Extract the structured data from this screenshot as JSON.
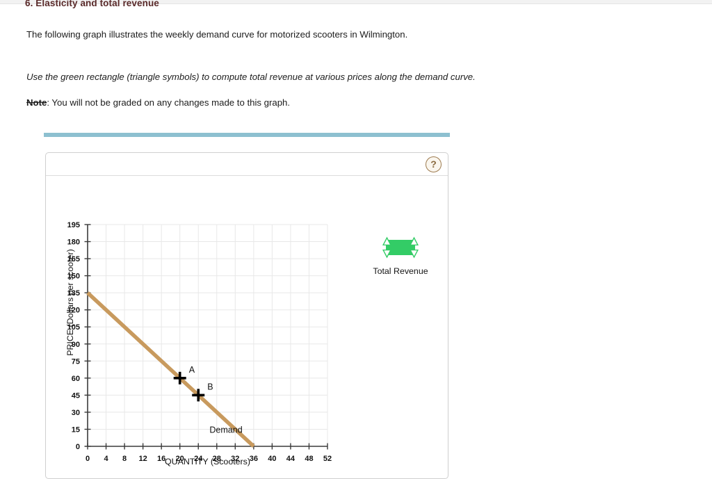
{
  "heading": "6. Elasticity and total revenue",
  "paragraphs": {
    "intro": "The following graph illustrates the weekly demand curve for motorized scooters in Wilmington.",
    "instruction": "Use the green rectangle (triangle symbols) to compute total revenue at various prices along the demand curve.",
    "note_label": "Note",
    "note_text": ": You will not be graded on any changes made to this graph."
  },
  "panel": {
    "help_icon_glyph": "?",
    "help_icon_name": "question-mark-icon"
  },
  "legend": {
    "label": "Total Revenue",
    "swatch_color": "#33cc66",
    "swatch_name": "green-rectangle-handles-icon"
  },
  "colors": {
    "teal_bar": "#8dc0d0",
    "demand_curve": "#c89a5e",
    "grid": "#e8e8e8",
    "axis": "#3a3a3a",
    "marker": "#000000",
    "heading": "#5a2a2a"
  },
  "chart_data": {
    "type": "line",
    "title": "",
    "xlabel": "QUANTITY (Scooters)",
    "ylabel": "PRICE (Dollars per scooter)",
    "xlim": [
      0,
      52
    ],
    "ylim": [
      0,
      195
    ],
    "xticks": [
      0,
      4,
      8,
      12,
      16,
      20,
      24,
      28,
      32,
      36,
      40,
      44,
      48,
      52
    ],
    "yticks": [
      0,
      15,
      30,
      45,
      60,
      75,
      90,
      105,
      120,
      135,
      150,
      165,
      180,
      195
    ],
    "grid": true,
    "legend_position": "right",
    "series": [
      {
        "name": "Demand",
        "label": "Demand",
        "label_x": 30,
        "label_y": 12,
        "color": "#c89a5e",
        "x": [
          0,
          36
        ],
        "y": [
          135,
          0
        ]
      }
    ],
    "points": [
      {
        "label": "A",
        "x": 20,
        "y": 60,
        "marker": "plus"
      },
      {
        "label": "B",
        "x": 24,
        "y": 45,
        "marker": "plus"
      }
    ],
    "annotations": [
      {
        "text": "Demand",
        "x": 30,
        "y": 12
      },
      {
        "text": "A",
        "x": 20,
        "y": 60
      },
      {
        "text": "B",
        "x": 24,
        "y": 45
      }
    ]
  }
}
